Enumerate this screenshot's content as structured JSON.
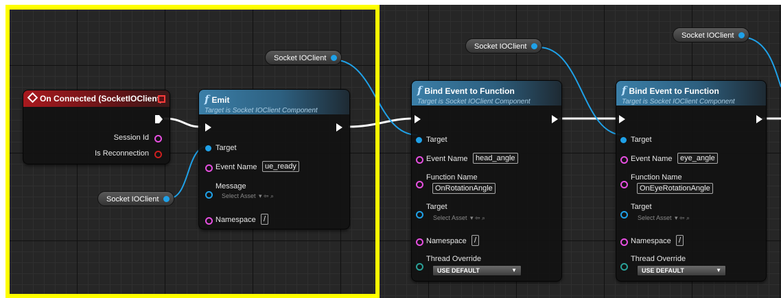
{
  "nodes": {
    "on_connected": {
      "title": "On Connected (SocketIOClient)",
      "pins": {
        "session_id": "Session Id",
        "is_reconnection": "Is Reconnection"
      }
    },
    "emit": {
      "title": "Emit",
      "subtitle": "Target is Socket IOClient Component",
      "pins": {
        "target": "Target",
        "event_name": "Event Name",
        "message": "Message",
        "namespace": "Namespace"
      },
      "event_name_value": "ue_ready",
      "message_value": "Select Asset",
      "namespace_value": "/"
    },
    "bind1": {
      "title": "Bind Event to Function",
      "subtitle": "Target is Socket IOClient Component",
      "pins": {
        "target": "Target",
        "event_name": "Event Name",
        "function_name": "Function Name",
        "target2": "Target",
        "namespace": "Namespace",
        "thread_override": "Thread Override"
      },
      "event_name_value": "head_angle",
      "function_name_value": "OnRotationAngle",
      "target2_value": "Select Asset",
      "namespace_value": "/",
      "thread_override_value": "USE DEFAULT"
    },
    "bind2": {
      "title": "Bind Event to Function",
      "subtitle": "Target is Socket IOClient Component",
      "pins": {
        "target": "Target",
        "event_name": "Event Name",
        "function_name": "Function Name",
        "target2": "Target",
        "namespace": "Namespace",
        "thread_override": "Thread Override"
      },
      "event_name_value": "eye_angle",
      "function_name_value": "OnEyeRotationAngle",
      "target2_value": "Select Asset",
      "namespace_value": "/",
      "thread_override_value": "USE DEFAULT"
    }
  },
  "variables": {
    "var1": "Socket IOClient",
    "var2": "Socket IOClient",
    "var3": "Socket IOClient",
    "var4": "Socket IOClient"
  },
  "colors": {
    "exec": "#ffffff",
    "object_pin": "#1fa1e8",
    "string_pin": "#e64fe0",
    "highlight": "#ffff00"
  }
}
